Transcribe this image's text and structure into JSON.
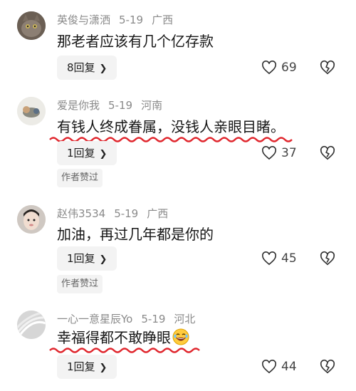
{
  "comments": [
    {
      "username": "英俊与潇洒",
      "date": "5-19",
      "location": "广西",
      "text": "那老者应该有几个亿存款",
      "reply_label": "8回复",
      "likes": "69",
      "author_liked": ""
    },
    {
      "username": "爱是你我",
      "date": "5-19",
      "location": "河南",
      "text": "有钱人终成眷属，没钱人亲眼目睹。",
      "reply_label": "1回复",
      "likes": "37",
      "author_liked": "作者赞过"
    },
    {
      "username": "赵伟3534",
      "date": "5-19",
      "location": "广西",
      "text": "加油，再过几年都是你的",
      "reply_label": "1回复",
      "likes": "45",
      "author_liked": "作者赞过"
    },
    {
      "username": "一心一意星辰Yo",
      "date": "5-19",
      "location": "河北",
      "text": "幸福得都不敢睁眼",
      "reply_label": "1回复",
      "likes": "44",
      "author_liked": ""
    }
  ],
  "icons": {
    "like": "heart-icon",
    "dislike": "broken-heart-icon",
    "reply_chevron": "chevron-right-icon",
    "emoji": "laughing-emoji-icon"
  },
  "colors": {
    "underline": "#e0262d",
    "meta_text": "#8a8a8a",
    "button_bg": "#f3f3f3"
  }
}
